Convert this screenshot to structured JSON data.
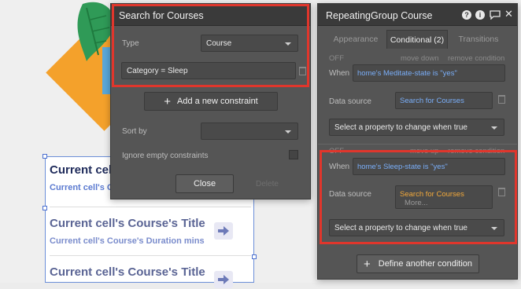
{
  "canvas": {
    "rows": [
      {
        "title": "Current cell's",
        "subtitle": "Current cell's C"
      },
      {
        "title": "Current cell's Course's Title",
        "subtitle": "Current cell's Course's Duration mins"
      },
      {
        "title": "Current cell's Course's Title",
        "subtitle": ""
      }
    ]
  },
  "search_panel": {
    "title": "Search for Courses",
    "type_label": "Type",
    "type_value": "Course",
    "constraint": "Category =  Sleep",
    "add_constraint": "Add a new constraint",
    "sort_by_label": "Sort by",
    "ignore_empty_label": "Ignore empty constraints",
    "close_label": "Close",
    "delete_label": "Delete"
  },
  "cond_panel": {
    "title": "RepeatingGroup Course",
    "tabs": [
      "Appearance",
      "Conditional (2)",
      "Transitions"
    ],
    "cond1": {
      "off": "OFF",
      "move_down": "move down",
      "remove": "remove condition",
      "when_label": "When",
      "when_value": "home's Meditate-state is \"yes\"",
      "ds_label": "Data source",
      "ds_value": "Search for Courses",
      "select_prop": "Select a property to change when true"
    },
    "cond2": {
      "off": "OFF",
      "move_up": "move up",
      "remove": "remove condition",
      "when_label": "When",
      "when_value": "home's Sleep-state is \"yes\"",
      "ds_label": "Data source",
      "ds_value": "Search for Courses",
      "more": "More...",
      "select_prop": "Select a property to change when true"
    },
    "define_another": "Define another condition"
  },
  "colors": {
    "highlight": "#e0362c",
    "link_blue": "#7aaef8",
    "link_orange": "#f2a93b"
  }
}
